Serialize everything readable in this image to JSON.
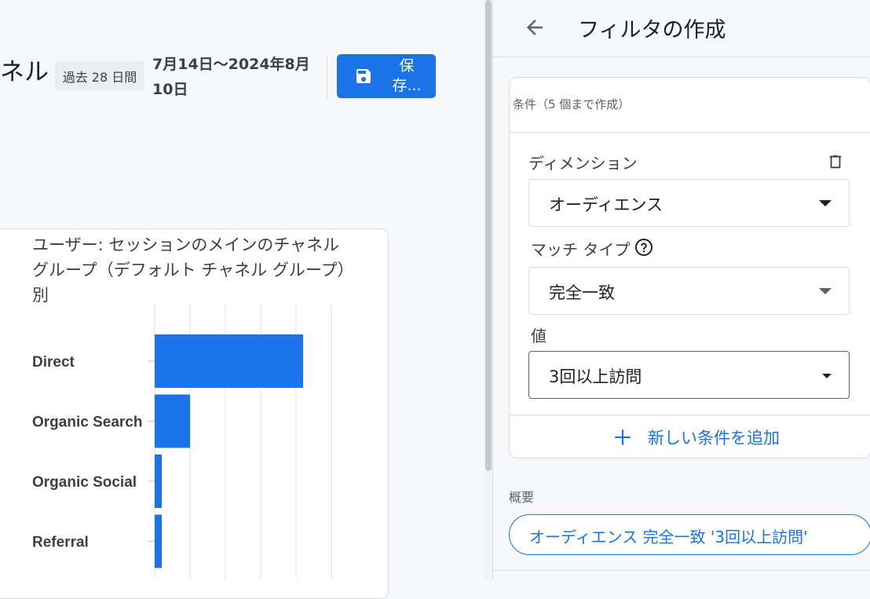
{
  "report": {
    "title_fragment": "ネル",
    "period_chip": "過去 28 日間",
    "date_range": "7月14日〜2024年8月10日",
    "save_label": "保存..."
  },
  "card": {
    "title": "ユーザー: セッションのメインのチャネル グループ（デフォルト チャネル グループ）別"
  },
  "chart_data": {
    "type": "bar",
    "orientation": "horizontal",
    "title": "ユーザー: セッションのメインのチャネル グループ（デフォルト チャネル グループ）別",
    "categories": [
      "Direct",
      "Organic Search",
      "Organic Social",
      "Referral"
    ],
    "values": [
      42,
      10,
      2,
      2
    ],
    "xlim": [
      0,
      50
    ],
    "grid": true,
    "color": "#1a73e8"
  },
  "panel": {
    "title": "フィルタの作成",
    "condition_header": "条件（5 個まで作成）",
    "dimension_label": "ディメンション",
    "dimension_value": "オーディエンス",
    "match_type_label": "マッチ タイプ",
    "match_type_value": "完全一致",
    "value_label": "値",
    "value_value": "3回以上訪問",
    "add_condition": "新しい条件を追加",
    "summary_label": "概要",
    "summary_value": "オーディエンス 完全一致 '3回以上訪問'"
  },
  "colors": {
    "accent": "#1a73e8",
    "background": "#f7f8fa"
  }
}
